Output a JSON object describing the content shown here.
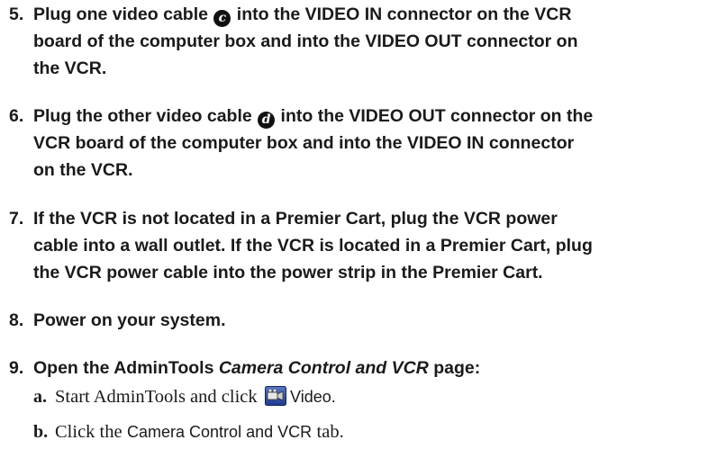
{
  "steps": [
    {
      "number": "5.",
      "line1_pre": "Plug one video cable ",
      "badge": "c",
      "line1_post": " into the VIDEO IN connector on the VCR",
      "line2": "board of the computer box and into the VIDEO OUT connector on",
      "line3": "the VCR."
    },
    {
      "number": "6.",
      "line1_pre": "Plug the other video cable ",
      "badge": "d",
      "line1_post": " into the VIDEO OUT connector on the",
      "line2": "VCR board of the computer box and into the VIDEO IN connector",
      "line3": "on the VCR."
    },
    {
      "number": "7.",
      "line1": "If the VCR is not located in a Premier Cart, plug the VCR power",
      "line2": "cable into a wall outlet. If the VCR is located in a Premier Cart, plug",
      "line3": "the VCR power cable into the power strip in the Premier Cart."
    },
    {
      "number": "8.",
      "line1": "Power on your system."
    },
    {
      "number": "9.",
      "line1_pre": "Open the AdminTools ",
      "line1_italic": "Camera Control and VCR",
      "line1_post": " page:"
    }
  ],
  "substeps": [
    {
      "letter": "a.",
      "pre": "Start AdminTools and click",
      "icon": "video-camera-icon",
      "label": "Video."
    },
    {
      "letter": "b.",
      "pre": "Click the",
      "label": "Camera Control and VCR",
      "post": "tab."
    }
  ]
}
